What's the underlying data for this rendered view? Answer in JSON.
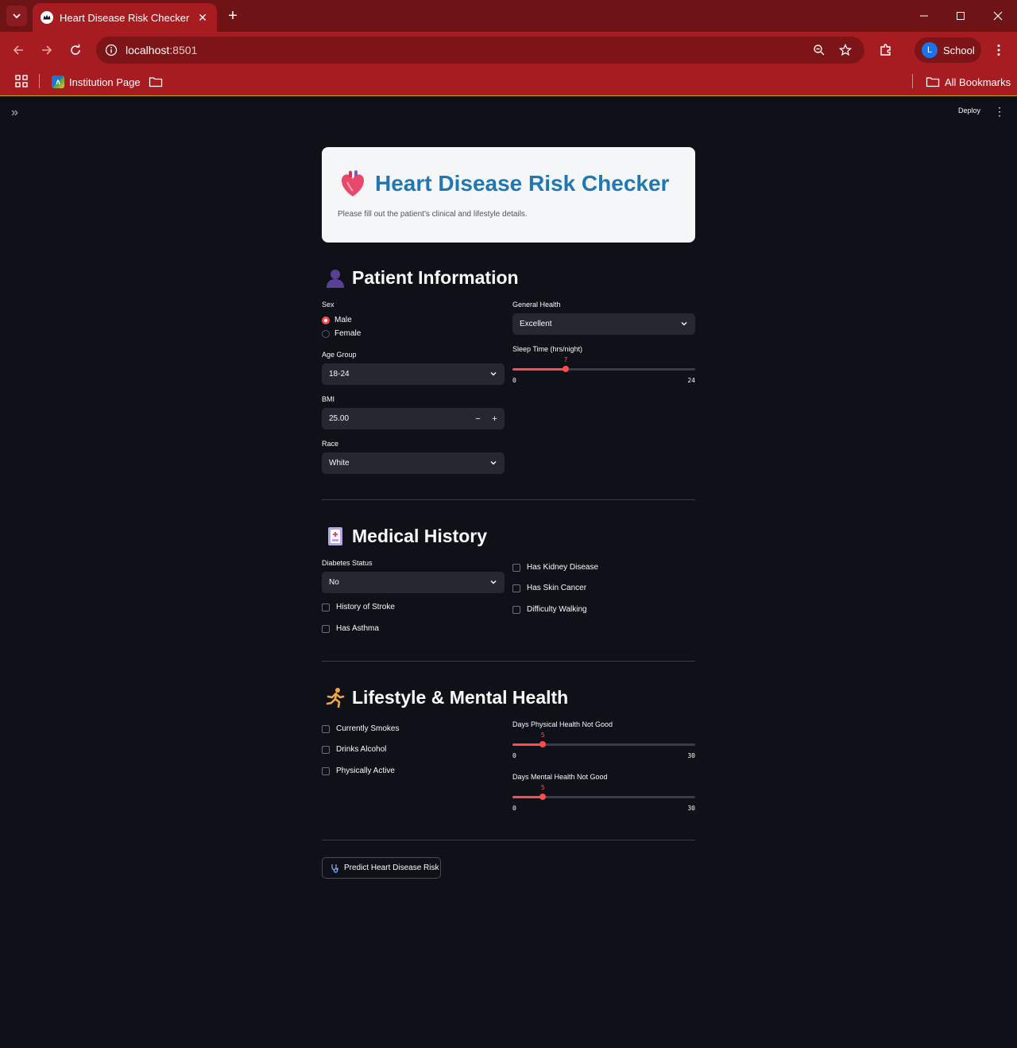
{
  "browser": {
    "tab_title": "Heart Disease Risk Checker",
    "url_host": "localhost",
    "url_port": ":8501",
    "profile_initial": "L",
    "profile_name": "School",
    "bookmarks": [
      "Institution Page"
    ],
    "all_bookmarks": "All Bookmarks",
    "theme_color": "#a61c20"
  },
  "app": {
    "deploy_label": "Deploy",
    "header": {
      "title": "Heart Disease Risk Checker",
      "subtitle": "Please fill out the patient's clinical and lifestyle details.",
      "title_color": "#1f77b4"
    },
    "patient": {
      "title": "Patient Information",
      "sex_label": "Sex",
      "sex_options": [
        "Male",
        "Female"
      ],
      "sex_selected": "Male",
      "age_label": "Age Group",
      "age_value": "18-24",
      "bmi_label": "BMI",
      "bmi_value": "25.00",
      "race_label": "Race",
      "race_value": "White",
      "general_health_label": "General Health",
      "general_health_value": "Excellent",
      "sleep_label": "Sleep Time (hrs/night)",
      "sleep_value": 7,
      "sleep_min": 0,
      "sleep_max": 24
    },
    "medical": {
      "title": "Medical History",
      "diabetes_label": "Diabetes Status",
      "diabetes_value": "No",
      "stroke": "History of Stroke",
      "asthma": "Has Asthma",
      "kidney": "Has Kidney Disease",
      "skin_cancer": "Has Skin Cancer",
      "walking": "Difficulty Walking"
    },
    "lifestyle": {
      "title": "Lifestyle & Mental Health",
      "smokes": "Currently Smokes",
      "alcohol": "Drinks Alcohol",
      "active": "Physically Active",
      "physical_label": "Days Physical Health Not Good",
      "physical_value": 5,
      "physical_min": 0,
      "physical_max": 30,
      "mental_label": "Days Mental Health Not Good",
      "mental_value": 5,
      "mental_min": 0,
      "mental_max": 30
    },
    "predict_label": "Predict Heart Disease Risk",
    "accent_color": "#ff4b4b"
  }
}
